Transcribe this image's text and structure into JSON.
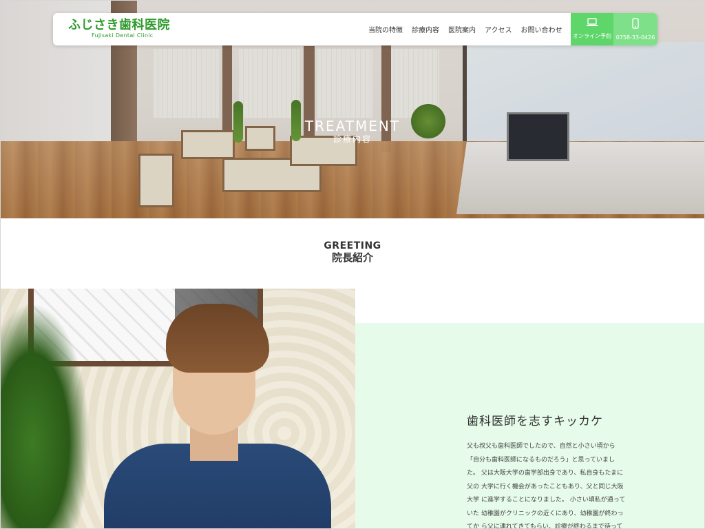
{
  "header": {
    "logo_name": "ふじさき歯科医院",
    "logo_sub": "Fujisaki Dental Clinic",
    "nav": [
      "当院の特徴",
      "診療内容",
      "医院案内",
      "アクセス",
      "お問い合わせ"
    ],
    "online_label": "オンライン予約",
    "online_icon": "laptop-icon",
    "phone_label": "0758-33-0426",
    "phone_icon": "smartphone-icon",
    "accent": "#5fd66a"
  },
  "hero": {
    "title_en": "TREATMENT",
    "title_ja": "診療内容"
  },
  "greeting": {
    "title_en": "GREETING",
    "title_ja": "院長紹介"
  },
  "profile": {
    "heading": "歯科医師を志すキッカケ",
    "lines": [
      "父も叔父も歯科医師でしたので、自然と小さい頃から",
      "「自分も歯科医師になるものだろう」と思っていまし",
      "た。 父は大阪大学の歯学部出身であり、私自身もたまに",
      "父の 大学に行く機会があったこともあり、父と同じ大阪",
      "大学 に進学することになりました。 小さい頃私が通って",
      "いた 幼稚園がクリニックの近くにあり、幼稚園が終わっ",
      "てか ら父に連れてきてもらい、診療が終わるまで待って"
    ],
    "panel_color": "#e6fbe9"
  }
}
